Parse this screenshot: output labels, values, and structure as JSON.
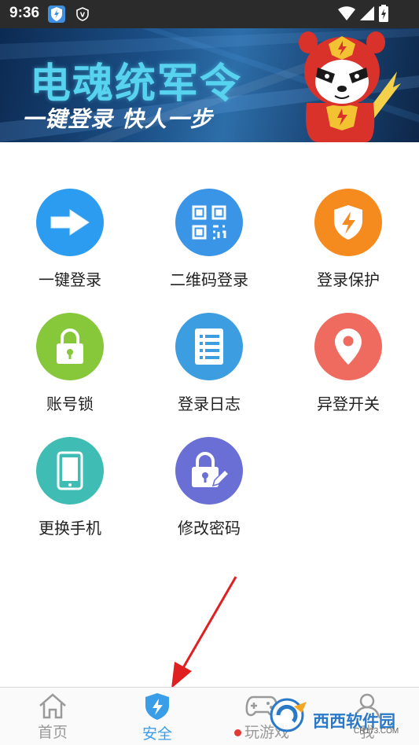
{
  "status_bar": {
    "time": "9:36"
  },
  "banner": {
    "title": "电魂统军令",
    "subtitle": "一键登录 快人一步"
  },
  "grid": {
    "items": [
      {
        "label": "一键登录",
        "icon": "arrow-right-icon",
        "color": "#2b9cf0"
      },
      {
        "label": "二维码登录",
        "icon": "qr-code-icon",
        "color": "#3b95e6"
      },
      {
        "label": "登录保护",
        "icon": "shield-lightning-icon",
        "color": "#f58a1f"
      },
      {
        "label": "账号锁",
        "icon": "padlock-icon",
        "color": "#86c83a"
      },
      {
        "label": "登录日志",
        "icon": "log-list-icon",
        "color": "#3c9ee0"
      },
      {
        "label": "异登开关",
        "icon": "location-pin-icon",
        "color": "#ef6a5f"
      },
      {
        "label": "更换手机",
        "icon": "phone-icon",
        "color": "#3fbcb3"
      },
      {
        "label": "修改密码",
        "icon": "lock-pencil-icon",
        "color": "#6a6fd6"
      }
    ]
  },
  "bottom_nav": {
    "items": [
      {
        "label": "首页",
        "icon": "home-icon",
        "active": false
      },
      {
        "label": "安全",
        "icon": "shield-icon",
        "active": true
      },
      {
        "label": "玩游戏",
        "icon": "gamepad-icon",
        "active": false
      },
      {
        "label": "我",
        "icon": "user-icon",
        "active": false
      }
    ]
  },
  "watermark": {
    "text": "西西软件园",
    "site": "CR173.COM"
  },
  "colors": {
    "accent": "#3a9de8",
    "status_bar": "#2b2b2b",
    "red_dot": "#e53935"
  }
}
